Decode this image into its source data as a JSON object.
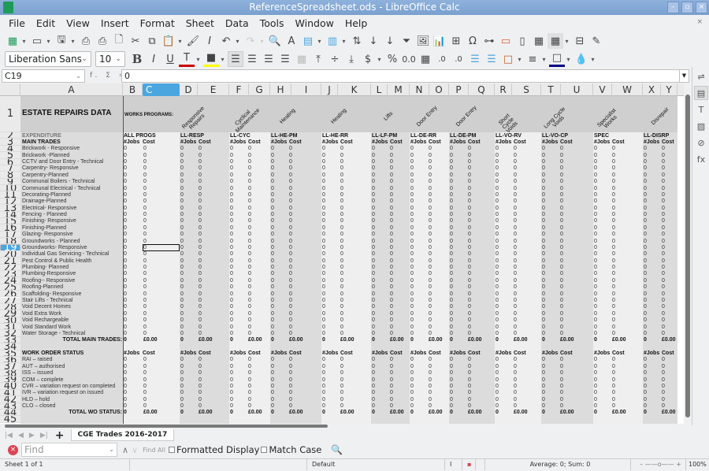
{
  "window": {
    "title": "ReferenceSpreadsheet.ods - LibreOffice Calc",
    "buttons": [
      "minimize",
      "maximize",
      "close"
    ]
  },
  "menu": [
    "File",
    "Edit",
    "View",
    "Insert",
    "Format",
    "Sheet",
    "Data",
    "Tools",
    "Window",
    "Help"
  ],
  "toolbar1": [
    "new-spreadsheet",
    "open",
    "save",
    "export-pdf",
    "print",
    "print-preview",
    "cut",
    "copy",
    "paste",
    "clone-formatting",
    "clear-formatting",
    "undo",
    "redo",
    "find-replace",
    "spelling",
    "row",
    "column",
    "sort",
    "sort-ascending",
    "sort-descending",
    "autofilter",
    "insert-image",
    "insert-chart",
    "pivot-table",
    "special-character",
    "hyperlink",
    "comment",
    "headers-footers",
    "define-print-area",
    "freeze-rows-columns",
    "split-window",
    "show-draw-functions"
  ],
  "toolbar2": {
    "font_name": "Liberation Sans",
    "font_size": "10",
    "buttons": [
      "bold",
      "italic",
      "underline",
      "font-color",
      "highlight-color",
      "align-left",
      "align-center",
      "align-right",
      "wrap-text",
      "merge-cells",
      "align-top",
      "center-vertically",
      "align-bottom",
      "currency",
      "percent",
      "number",
      "date",
      "add-decimal",
      "delete-decimal",
      "increase-indent",
      "decrease-indent",
      "borders",
      "border-style",
      "border-color",
      "conditional-format"
    ],
    "colors": {
      "font_color": "#cc0000",
      "highlight_color": "#ffff00",
      "border_color": "#000080"
    }
  },
  "formula_bar": {
    "cell_ref": "C19",
    "content": "0",
    "icons": "f. Σ ="
  },
  "columns": [
    "A",
    "B",
    "C",
    "D",
    "E",
    "F",
    "G",
    "H",
    "I",
    "J",
    "K",
    "L",
    "M",
    "N",
    "O",
    "P",
    "Q",
    "R",
    "S",
    "T",
    "U",
    "V",
    "W",
    "X",
    "Y"
  ],
  "selected_column": "C",
  "selected_row": 19,
  "sheet": {
    "title": "ESTATE REPAIRS DATA",
    "works_programs_label": "WORKS PROGRAMS:",
    "expenditure_label": "EXPENDITURE",
    "main_trades_label": "MAIN TRADES",
    "programs": [
      {
        "code": "ALL PROGS",
        "rotated": ""
      },
      {
        "code": "LL-RESP",
        "rotated": "Responsive Repairs"
      },
      {
        "code": "LL-CYC",
        "rotated": "Cyclical Maintenance"
      },
      {
        "code": "LL-HE-PM",
        "rotated": "Heating"
      },
      {
        "code": "LL-HE-RR",
        "rotated": "Heating"
      },
      {
        "code": "LL-LF-PM",
        "rotated": "Lifts"
      },
      {
        "code": "LL-DE-RR",
        "rotated": "Door Entry"
      },
      {
        "code": "LL-DE-PM",
        "rotated": "Door Entry"
      },
      {
        "code": "LL-VO-RV",
        "rotated": "Short Cycle Voids"
      },
      {
        "code": "LL-VO-CP",
        "rotated": "Long Cycle Voids"
      },
      {
        "code": "SPEC",
        "rotated": "Specialist Works"
      },
      {
        "code": "LL-DISRP",
        "rotated": "Disrepair"
      }
    ],
    "jobs_header": "#Jobs",
    "cost_header": "Cost",
    "trades": [
      "Brickwork - Responsive",
      "Brickwork -Planned",
      "CCTV and Door Entry - Technical",
      "Carpentry- Responsive",
      "Carpentry-Planned",
      "Communal Boilers - Technical",
      "Communal Electrical - Technical",
      "Decorating-Planned",
      "Drainage-Planned",
      "Electrical- Responsive",
      "Fencing - Planned",
      "Finishing- Responsive",
      "Finishing-Planned",
      "Glazing- Responsive",
      "Groundworks - Planned",
      "Groundworks- Responsive",
      "Individual Gas Servicing - Technical",
      "Pest Control & Public Health",
      "Plumbing- Planned",
      "Plumbing-Responsive",
      "Roofing-- Responsive",
      "Roofing-Planned",
      "Scaffolding- Responsive",
      "Stair Lifts - Technical",
      "Void Decent Homes",
      "Void Extra Work",
      "Void Rechargeable",
      "Void Standard Work",
      "Water Storage - Technical"
    ],
    "total_main_trades_label": "TOTAL MAIN TRADES:",
    "work_order_status_label": "WORK ORDER STATUS",
    "statuses": [
      "RAI – raised",
      "AUT – authorised",
      "ISS – issued",
      "COM – complete",
      "CVR – variation request on completed",
      "IVR – variation request on issued",
      "HLD – hold",
      "CLO – closed"
    ],
    "total_wo_status_label": "TOTAL WO STATUS:",
    "cell_value": "0",
    "total_jobs": "0",
    "total_cost": "£0.00"
  },
  "sheet_tabs": {
    "active": "CGE Trades 2016-2017"
  },
  "find_bar": {
    "placeholder": "Find",
    "find_all": "Find All",
    "formatted_display": "Formatted Display",
    "match_case": "Match Case",
    "formatted_display_checked": false,
    "match_case_checked": false
  },
  "status_bar": {
    "sheet_info": "Sheet 1 of 1",
    "page_style": "Default",
    "selection_stats": "Average: 0; Sum: 0",
    "zoom": "100%"
  }
}
